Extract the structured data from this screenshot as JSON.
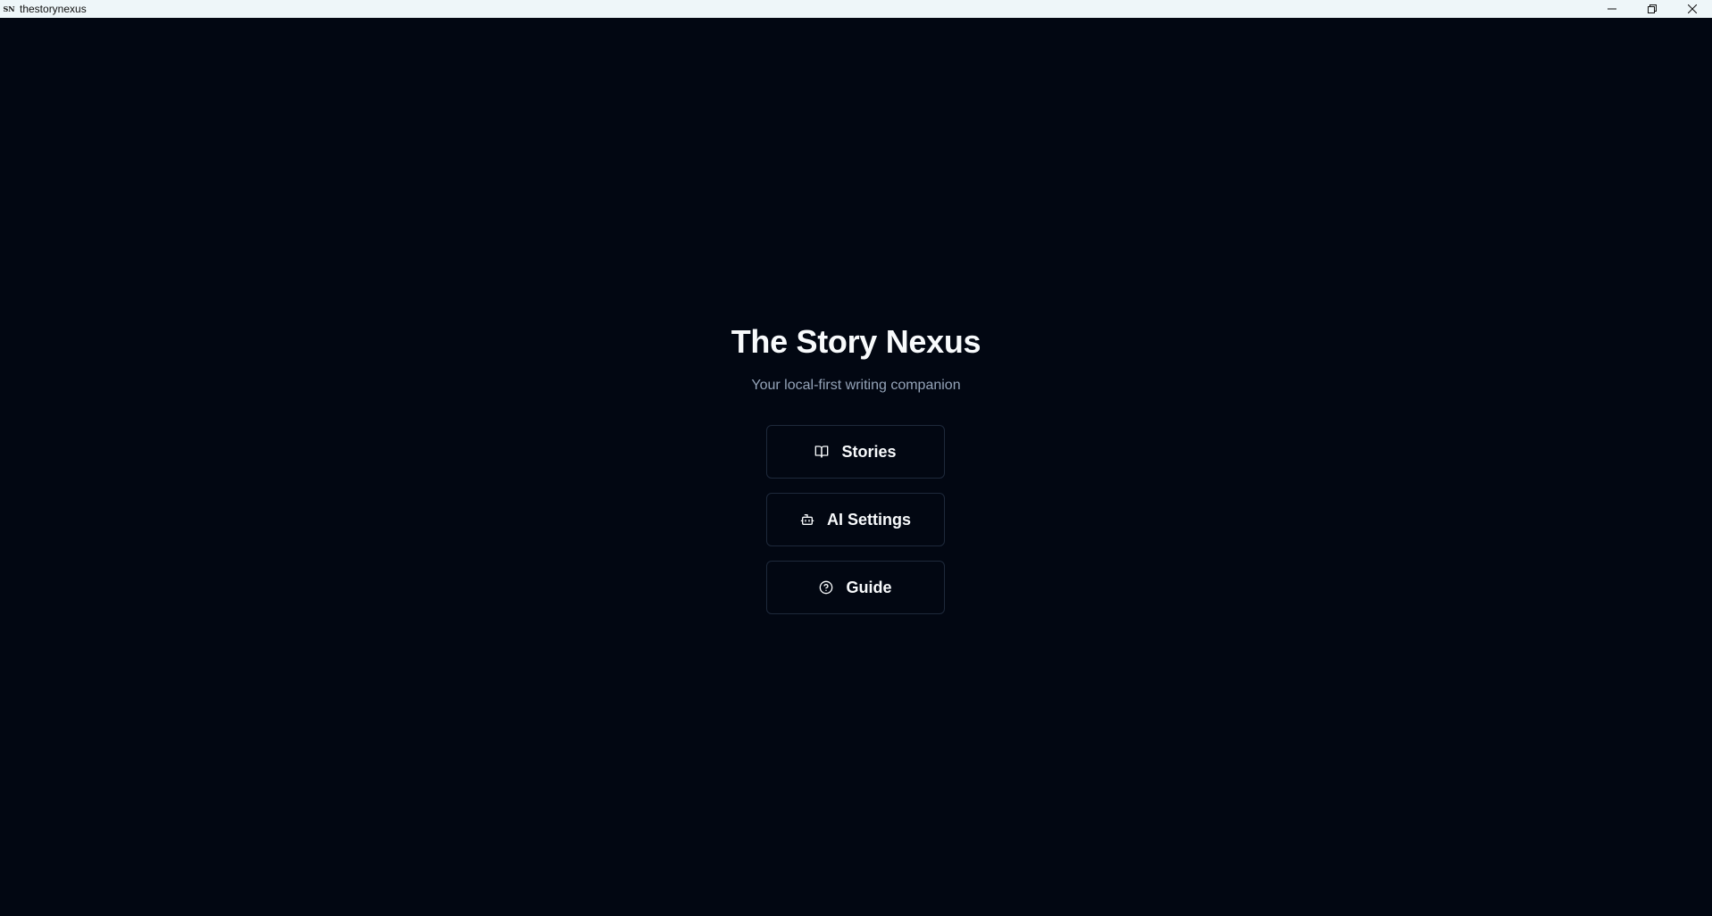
{
  "window": {
    "app_icon_text": "SN",
    "title": "thestorynexus"
  },
  "home": {
    "title": "The Story Nexus",
    "subtitle": "Your local-first writing companion"
  },
  "menu": [
    {
      "label": "Stories",
      "icon": "book-open-icon"
    },
    {
      "label": "AI Settings",
      "icon": "bot-icon"
    },
    {
      "label": "Guide",
      "icon": "help-circle-icon"
    }
  ],
  "colors": {
    "background": "#020712",
    "titlebar": "#eef6f9",
    "border": "#1e293b",
    "text": "#f8fafc",
    "muted": "#94a3b8"
  }
}
